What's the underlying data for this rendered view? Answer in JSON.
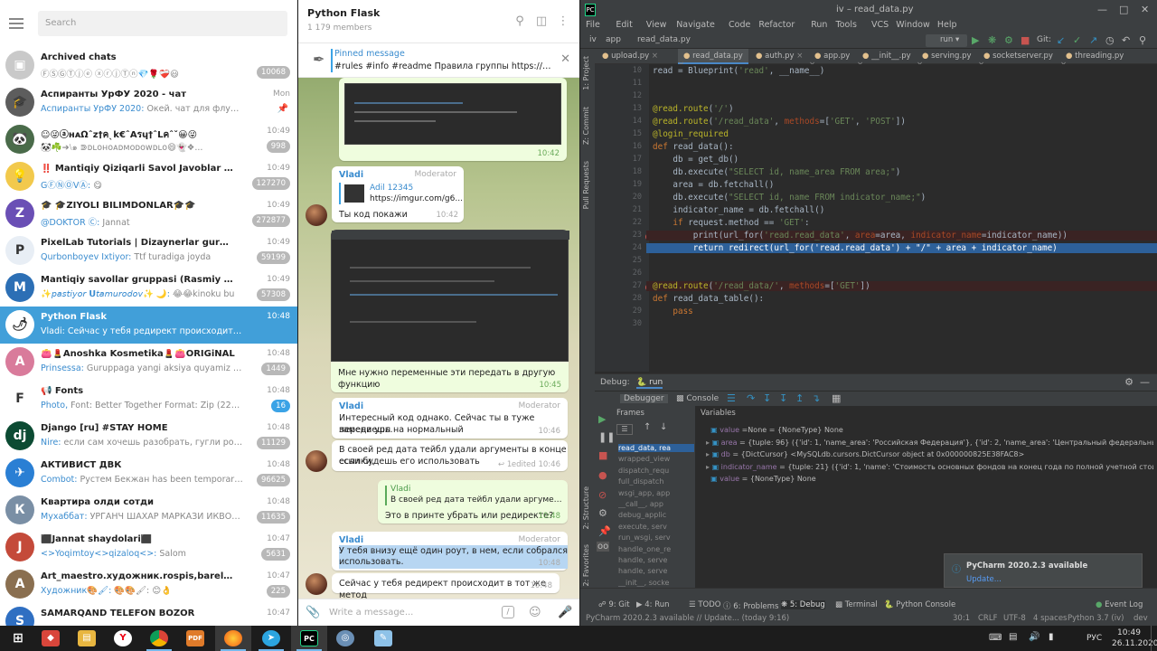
{
  "telegram": {
    "search_placeholder": "Search",
    "chats": [
      {
        "name": "Archived chats",
        "time": "",
        "preview": "ⒻⓈⒼⓉⓙⓔ ⓧⓡⓙⓉⓝ💎🌹❤️‍🩹😃",
        "who": "",
        "badge": "10068",
        "badge_blue": false,
        "avatar": "#c9c9c9",
        "initial": "▣"
      },
      {
        "name": "Аспиранты УрФУ 2020 - чат",
        "time": "Mon",
        "preview": " Окей. чат для флуда (а также рекламы...",
        "who": "Аспиранты УрФУ 2020:",
        "badge": "",
        "badge_blue": false,
        "avatar": "#5d5d5d",
        "initial": "🎓",
        "pinned": true
      },
      {
        "name": "☺😜ⓐʜᴀΩˆz†คˎk€ˆAรɥ†ˆLคˆˇ😀😜",
        "time": "10:49",
        "preview": "🐼☘️➔⧵๑ ⋑ᴅʟᴏʜᴏᴀᴅᴍᴏᴅᴏᴡᴅʟᴏ😄👻❖...",
        "who": "",
        "badge": "998",
        "badge_blue": false,
        "avatar": "#4a6b4a",
        "initial": "🐼"
      },
      {
        "name": "‼️ Mantiqiy Qiziqarli Savol Javoblar ‼️",
        "time": "10:49",
        "preview": " 😋",
        "who": "GⒻⓃⓄVⒶ:",
        "badge": "127270",
        "badge_blue": false,
        "avatar": "#f2c94c",
        "initial": "💡"
      },
      {
        "name": "🎓 🎓ZIYOLI BILIMDONLAR🎓🎓",
        "time": "10:49",
        "preview": " Jannat",
        "who": "@DOKTOR Ⓒ:",
        "badge": "272877",
        "badge_blue": false,
        "avatar": "#6a4fb5",
        "initial": "Z"
      },
      {
        "name": "PixelLab Tutorials | Dizaynerlar guruhi",
        "time": "10:49",
        "preview": " Ttf turadiga joyda",
        "who": "Qurbonboyev Ixtiyor:",
        "badge": "59199",
        "badge_blue": false,
        "avatar": "#e8eef5",
        "initial": "P"
      },
      {
        "name": "Mantiqiy savollar gruppasi (Rasmiy guruh✔️)",
        "time": "10:49",
        "preview": " 😂😂kinoku bu",
        "who": "✨𝘱𝘢𝘴𝘵𝘪𝘺𝘰𝘳 𝗨𝘵𝘢𝘮𝘶𝘳𝘰𝘥𝘰𝘷✨ 🌙:",
        "badge": "57308",
        "badge_blue": false,
        "avatar": "#2c6fb5",
        "initial": "M"
      },
      {
        "name": "Python Flask",
        "time": "10:48",
        "preview": " Сейчас у тебя редирект происходит в тот же метод",
        "who": "Vladi:",
        "badge": "",
        "badge_blue": false,
        "avatar": "#ffffff",
        "initial": "🌶",
        "selected": true
      },
      {
        "name": "👛💄Anoshka Kosmetika💄👛ORIGiNAL",
        "time": "10:48",
        "preview": " Guruppaga yangi aksiya quyamiz aksiyamiz loto gi...",
        "who": "Prinsessa:",
        "badge": "1449",
        "badge_blue": false,
        "avatar": "#d97b9b",
        "initial": "A"
      },
      {
        "name": "📢 Fonts",
        "time": "10:48",
        "preview": " Font: Better Together Format: Zip (220.6 KB) Author: Kat...",
        "who": "Photo,",
        "badge": "16",
        "badge_blue": true,
        "avatar": "#ffffff",
        "initial": "F"
      },
      {
        "name": "Django [ru] #STAY HOME",
        "time": "10:48",
        "preview": " если сам хочешь разобрать, гугли postgis или тип р...",
        "who": "Nire:",
        "badge": "11129",
        "badge_blue": false,
        "avatar": "#0c4b33",
        "initial": "dj"
      },
      {
        "name": "АКТИВИСТ ДВК",
        "time": "10:48",
        "preview": " Рустем Бекжан has been temporarily muted for 4...",
        "who": "Combot:",
        "badge": "96625",
        "badge_blue": false,
        "avatar": "#2a7fd4",
        "initial": "✈"
      },
      {
        "name": "Квартира олди сотди",
        "time": "10:48",
        "preview": " УРГАНЧ ШАХАР МАРКАЗИ ИКВОЛ СУТУДИЯ Е...",
        "who": "Мухаббат:",
        "badge": "11635",
        "badge_blue": false,
        "avatar": "#7a8fa5",
        "initial": "К"
      },
      {
        "name": "⬛️Jannat shaydolari⬛️",
        "time": "10:47",
        "preview": " Salom",
        "who": "<>Yoqimtoy<>qizaloq<>:",
        "badge": "5631",
        "badge_blue": false,
        "avatar": "#c44a3a",
        "initial": "J"
      },
      {
        "name": "Art_maestro.художник.rospis,barelyef,3d,adelka uy be...",
        "time": "10:47",
        "preview": " 🎨🎨🖌: 😊👌",
        "who": "Художник🎨🖌:",
        "badge": "225",
        "badge_blue": false,
        "avatar": "#8a6f50",
        "initial": "A"
      },
      {
        "name": "SAMARQAND TELEFON BOZOR",
        "time": "10:47",
        "preview": "",
        "who": "",
        "badge": "",
        "badge_blue": false,
        "avatar": "#2f6fc2",
        "initial": "S"
      }
    ],
    "group_title": "Python Flask",
    "group_members": "1 179 members",
    "pinned_label": "Pinned message",
    "pinned_text": "#rules #info #readme Правила группы  https://telegra...",
    "messages": [
      {
        "id": "m0",
        "time": "10:42"
      },
      {
        "id": "m1",
        "author": "Vladi",
        "role": "Moderator",
        "reply_author": "Adil 12345",
        "reply_text": "https://imgur.com/g6...",
        "text": "Ты код покажи",
        "time": "10:42"
      },
      {
        "id": "m2",
        "text": "Мне нужно переменные эти передать в другую функцию",
        "time": "10:45"
      },
      {
        "id": "m3",
        "author": "Vladi",
        "role": "Moderator",
        "line1": "Интересный код однако. Сейчас ты в туже передаешь.",
        "line2": "замени урл на нормальный",
        "time": "10:46"
      },
      {
        "id": "m4",
        "line1": "В своей ред дата тейбл удали аргументы в конце ссылки,",
        "line2": "если будешь его использовать",
        "replies": "1",
        "edited": "edited 10:46"
      },
      {
        "id": "m5",
        "reply_author": "Vladi",
        "reply_text": "В своей ред дата тейбл удали аргументы в ...",
        "text": "Это в принте убрать или редиректе?",
        "time": "10:48"
      },
      {
        "id": "m6",
        "author": "Vladi",
        "role": "Moderator",
        "line1": "У тебя внизу ещё один роут, в нем, если собрался его",
        "line2": "использовать.",
        "time": "10:48"
      },
      {
        "id": "m7",
        "text": "Сейчас у тебя редирект происходит в тот же метод",
        "time": "10:48"
      }
    ],
    "input_placeholder": "Write a message..."
  },
  "pycharm": {
    "window_title": "iv – read_data.py",
    "menu": [
      "File",
      "Edit",
      "View",
      "Navigate",
      "Code",
      "Refactor",
      "Run",
      "Tools",
      "VCS",
      "Window",
      "Help"
    ],
    "breadcrumb": [
      "iv",
      "app",
      "read_data.py"
    ],
    "run_config": "run",
    "git_label": "Git:",
    "tabs": [
      "upload.py",
      "read_data.py",
      "auth.py",
      "app.py",
      "__init__.py",
      "serving.py",
      "socketserver.py",
      "threading.py"
    ],
    "active_tab": 1,
    "left_tools": [
      "1: Project",
      "Z: Commit",
      "Pull Requests"
    ],
    "code_lines": [
      {
        "n": "10",
        "html": "read = Blueprint('read', __name__)"
      },
      {
        "n": "11",
        "html": ""
      },
      {
        "n": "12",
        "html": ""
      },
      {
        "n": "13",
        "html": "@read.route('/')"
      },
      {
        "n": "14",
        "html": "@read.route('/read_data', methods=['GET', 'POST'])"
      },
      {
        "n": "15",
        "html": "@login_required"
      },
      {
        "n": "16",
        "html": "def read_data():"
      },
      {
        "n": "17",
        "html": "    db = get_db()"
      },
      {
        "n": "18",
        "html": "    db.execute(\"SELECT id, name_area FROM area;\")"
      },
      {
        "n": "19",
        "html": "    area = db.fetchall()"
      },
      {
        "n": "20",
        "html": "    db.execute(\"SELECT id, name FROM indicator_name;\")"
      },
      {
        "n": "21",
        "html": "    indicator_name = db.fetchall()"
      },
      {
        "n": "22",
        "html": "    if request.method == 'GET':"
      },
      {
        "n": "23",
        "html": "        print(url_for('read.read_data', area=area, indicator_name=indicator_name))"
      },
      {
        "n": "24",
        "html": "        return redirect(url_for('read.read_data') + \"/\" + area + indicator_name)"
      },
      {
        "n": "25",
        "html": ""
      },
      {
        "n": "26",
        "html": ""
      },
      {
        "n": "27",
        "html": "@read.route('/read_data/', methods=['GET'])"
      },
      {
        "n": "28",
        "html": "def read_data_table():"
      },
      {
        "n": "29",
        "html": "    pass"
      },
      {
        "n": "30",
        "html": ""
      }
    ],
    "debug_label": "Debug:",
    "debug_run": "run",
    "debugger_tab": "Debugger",
    "console_tab": "Console",
    "frames_label": "Frames",
    "variables_label": "Variables",
    "frames": [
      "read_data, rea",
      "wrapped_view",
      "dispatch_requ",
      "full_dispatch",
      "wsgi_app, app",
      "__call__, app",
      "debug_applic",
      "execute, serv",
      "run_wsgi, serv",
      "handle_one_re",
      "handle, serve",
      "handle, serve",
      "__init__, socke"
    ],
    "variables": [
      {
        "name": "value",
        "rest": " =None = {NoneType} None"
      },
      {
        "name": "area",
        "rest": " = {tuple: 96} ({'id': 1, 'name_area': 'Российская Федерация'}, {'id': 2, 'name_area': 'Центральный федеральный округ'}, {'id': 3"
      },
      {
        "name": "db",
        "rest": " = {DictCursor} <MySQLdb.cursors.DictCursor object at 0x000000825E38FAC8>"
      },
      {
        "name": "indicator_name",
        "rest": " = {tuple: 21} ({'id': 1, 'name': 'Стоимость основных фондов на конец года по полной учетной стоимости, млн."
      },
      {
        "name": "value",
        "rest": " = {NoneType} None"
      }
    ],
    "notif_title": "PyCharm 2020.2.3 available",
    "notif_link": "Update...",
    "bottom_tools": [
      "9: Git",
      "4: Run",
      "TODO",
      "6: Problems",
      "5: Debug",
      "Terminal",
      "Python Console"
    ],
    "event_log": "Event Log",
    "side_tools": [
      "2: Structure",
      "2: Favorites"
    ],
    "status_left": "PyCharm 2020.2.3 available // Update... (today 9:16)",
    "status_right": [
      "30:1",
      "CRLF",
      "UTF-8",
      "4 spaces",
      "Python 3.7 (iv)",
      "dev"
    ]
  },
  "taskbar": {
    "lang": "РУС",
    "time": "10:49",
    "date": "26.11.2020"
  }
}
